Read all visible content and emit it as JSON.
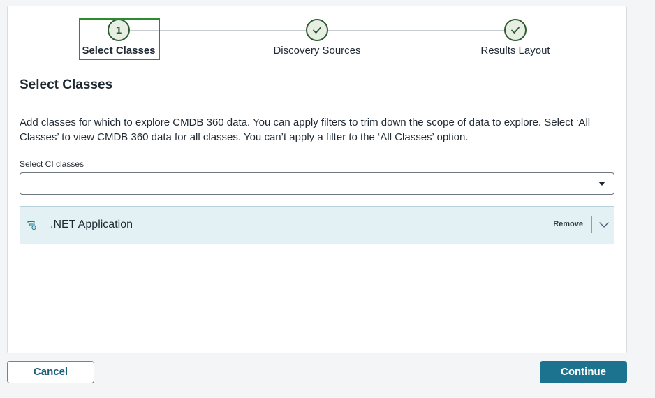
{
  "stepper": {
    "steps": [
      {
        "number": "1",
        "label": "Select Classes",
        "state": "active",
        "icon": ""
      },
      {
        "number": "",
        "label": "Discovery Sources",
        "state": "complete",
        "icon": "checkmark-icon"
      },
      {
        "number": "",
        "label": "Results Layout",
        "state": "complete",
        "icon": "checkmark-icon"
      }
    ]
  },
  "section": {
    "title": "Select Classes",
    "description": "Add classes for which to explore CMDB 360 data. You can apply filters to trim down the scope of data to explore. Select ‘All Classes’ to view CMDB 360 data for all classes. You can’t apply a filter to the ‘All Classes’ option."
  },
  "ci_select": {
    "label": "Select CI classes",
    "value": ""
  },
  "selected_classes": [
    {
      "name": ".NET Application",
      "icon": "application-class-icon",
      "remove_label": "Remove"
    }
  ],
  "footer": {
    "cancel_label": "Cancel",
    "continue_label": "Continue"
  },
  "colors": {
    "accent": "#1b738f",
    "step_complete": "#2e5c2e",
    "active_frame": "#2f8a2f",
    "row_background": "#e3f0f4"
  }
}
